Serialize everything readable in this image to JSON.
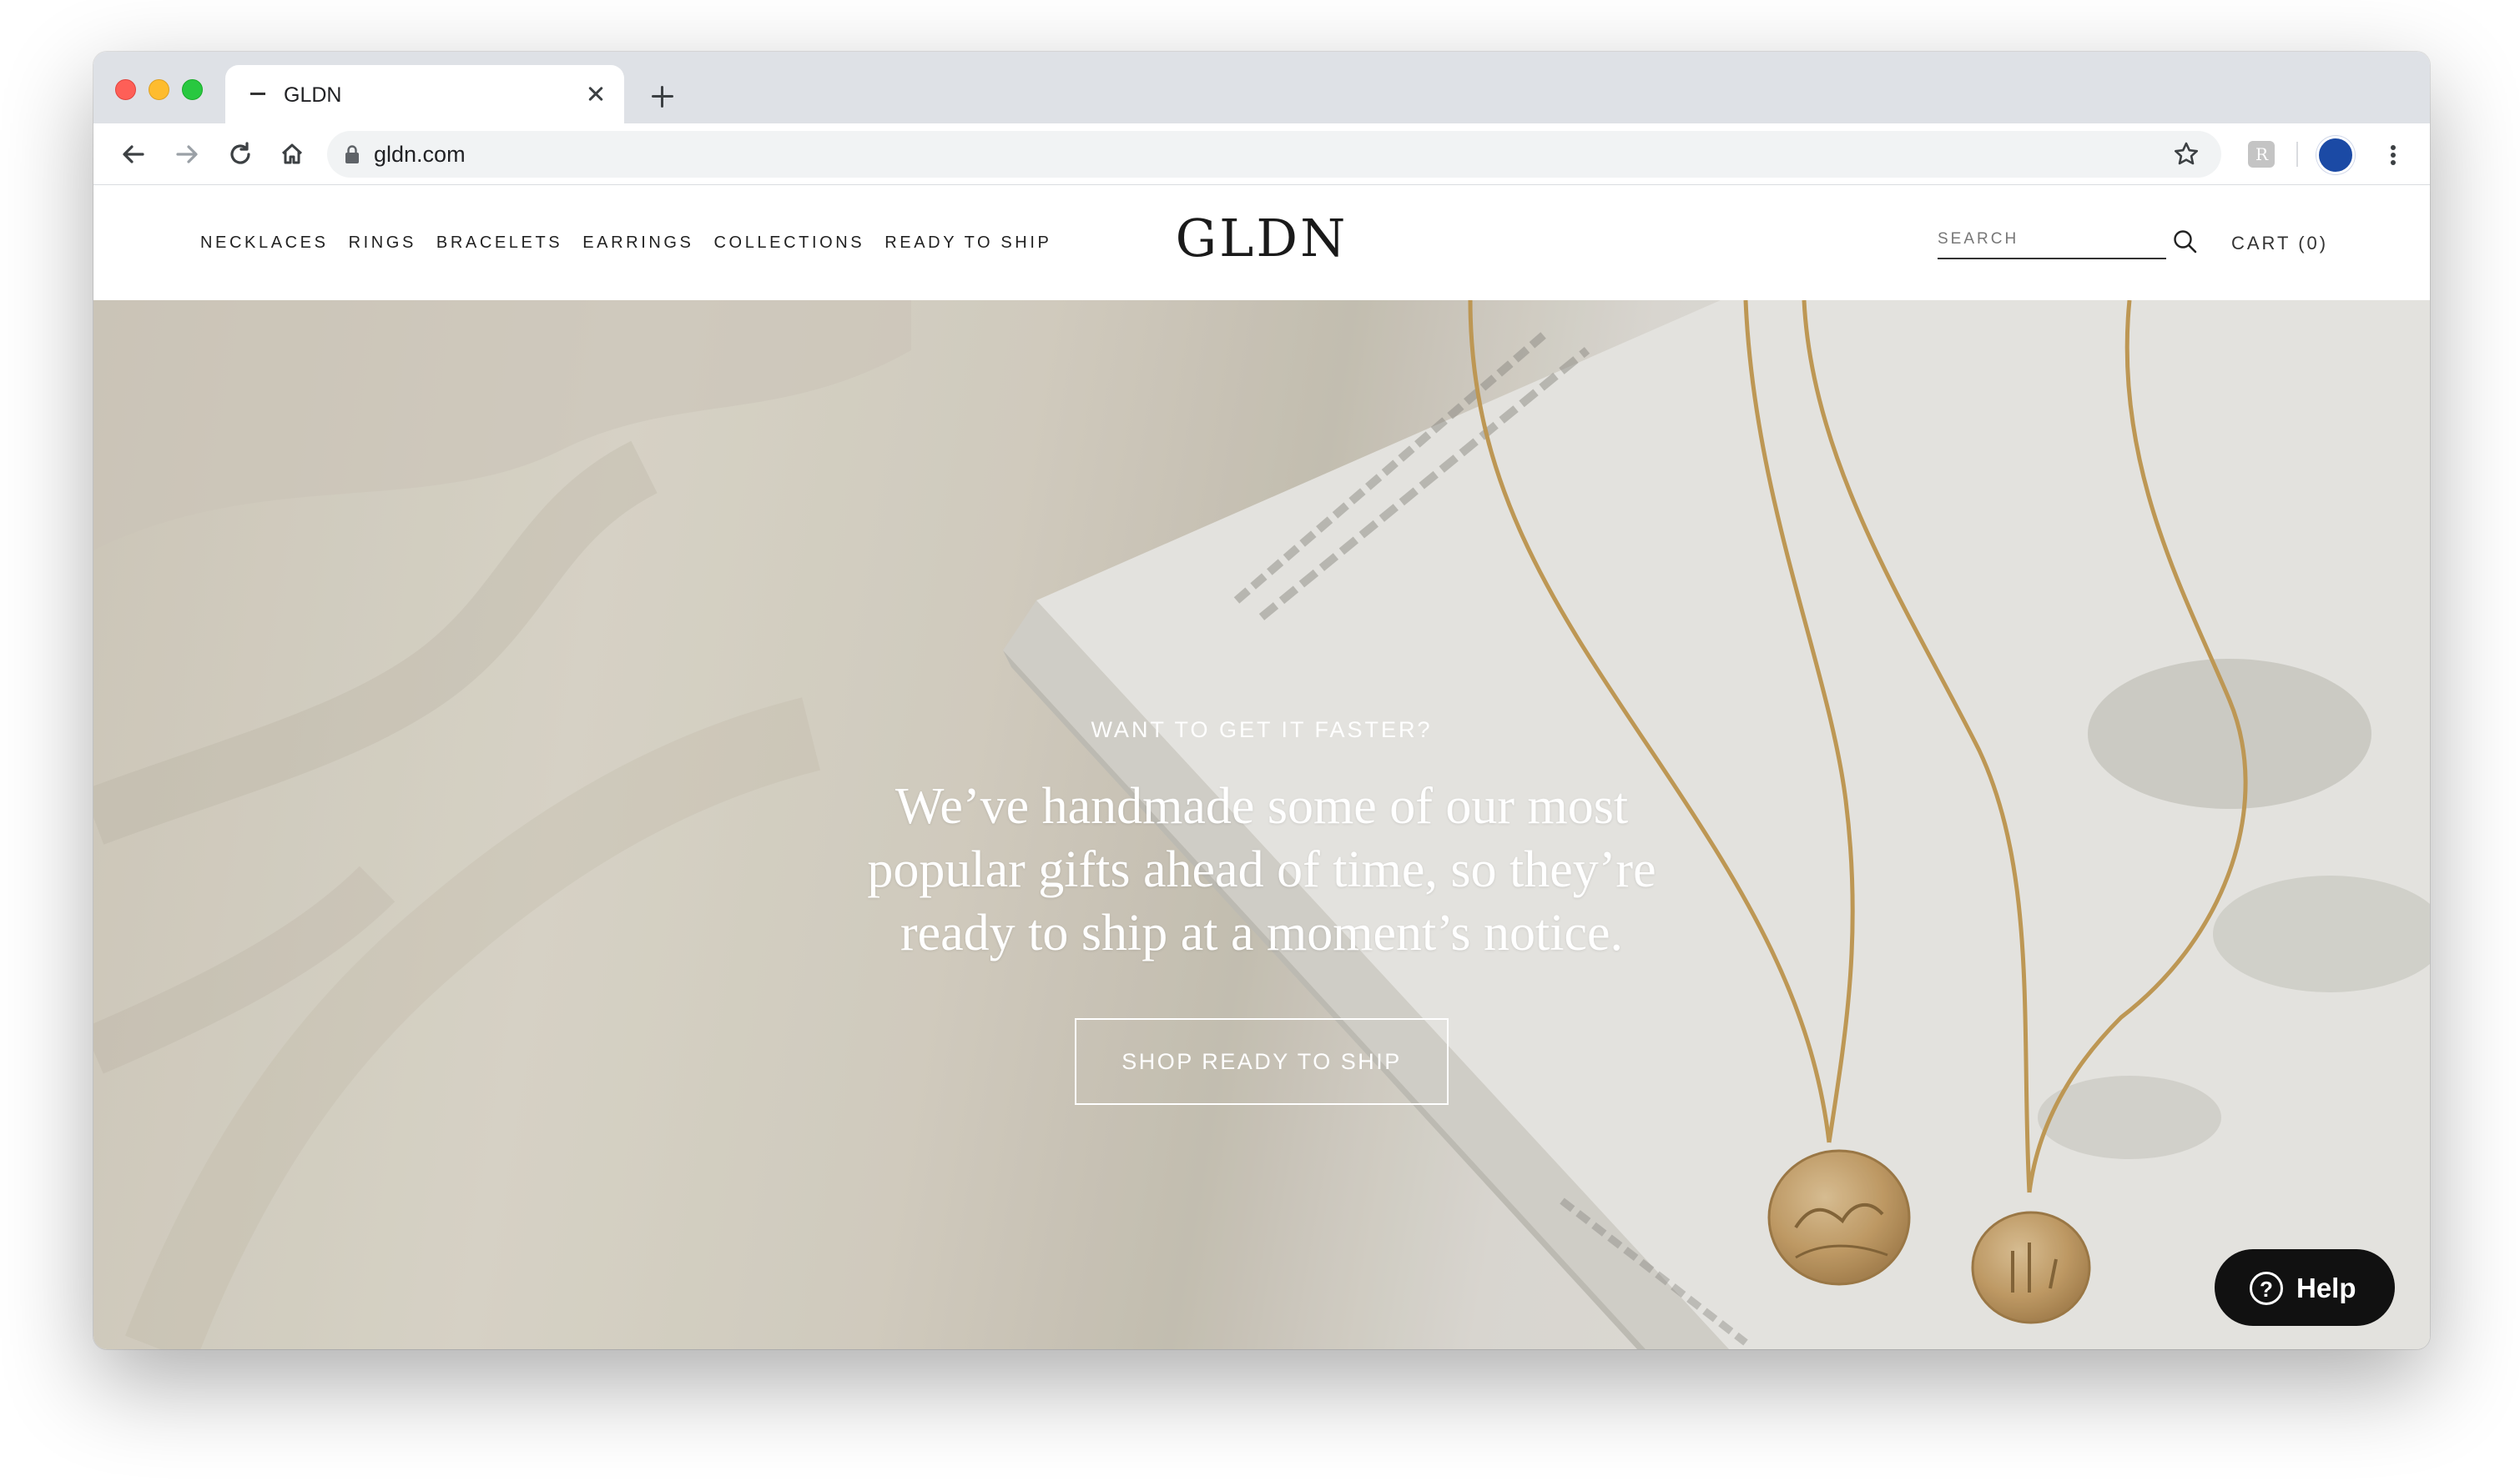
{
  "browser": {
    "tab_title": "GLDN",
    "url": "gldn.com",
    "icons": [
      "back-icon",
      "forward-icon",
      "reload-icon",
      "home-icon",
      "lock-icon",
      "star-icon",
      "extension-icon",
      "avatar",
      "menu-icon",
      "new-tab-icon",
      "close-icon"
    ],
    "extension_letter": "R"
  },
  "site": {
    "nav": [
      {
        "label": "NECKLACES"
      },
      {
        "label": "RINGS"
      },
      {
        "label": "BRACELETS"
      },
      {
        "label": "EARRINGS"
      },
      {
        "label": "COLLECTIONS"
      },
      {
        "label": "READY TO SHIP"
      }
    ],
    "logo": "GLDN",
    "search_placeholder": "SEARCH",
    "cart_label": "CART (0)"
  },
  "hero": {
    "eyebrow": "WANT TO GET IT FASTER?",
    "headline": "We’ve handmade some of our most popular gifts ahead of time, so they’re ready to ship at a moment’s notice.",
    "cta_label": "SHOP READY TO SHIP"
  },
  "help": {
    "label": "Help",
    "icon_glyph": "?"
  },
  "colors": {
    "accent_dark": "#111111",
    "hero_text": "#ffffff",
    "chain_gold": "#c9a15a"
  }
}
